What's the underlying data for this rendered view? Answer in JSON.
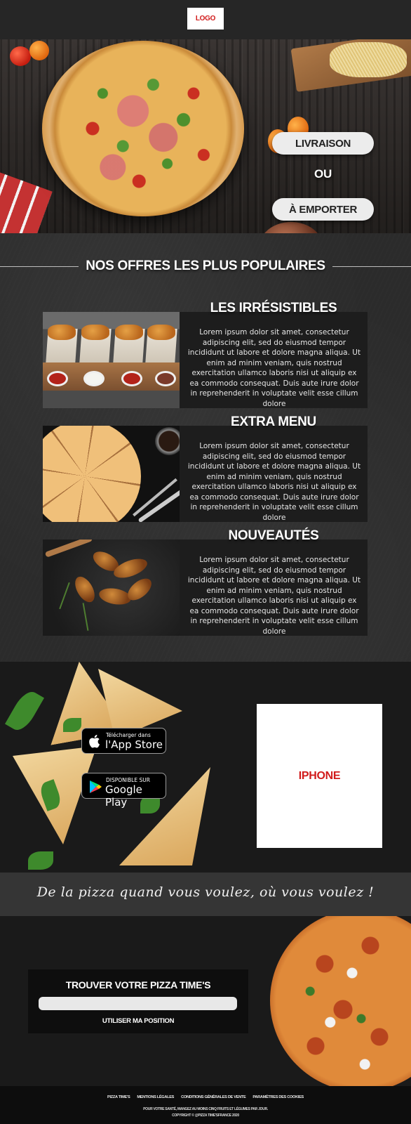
{
  "header": {
    "logo_label": "LOGO"
  },
  "hero": {
    "delivery_button": "LIVRAISON",
    "or_text": "OU",
    "takeaway_button": "À EMPORTER"
  },
  "offers": {
    "title": "NOS OFFRES LES PLUS POPULAIRES",
    "items": [
      {
        "title": "LES IRRÉSISTIBLES",
        "text": "Lorem ipsum dolor sit amet, consectetur adipiscing elit, sed do eiusmod tempor incididunt ut labore et dolore magna aliqua. Ut enim ad minim veniam, quis nostrud exercitation ullamco laboris nisi ut aliquip ex ea commodo consequat. Duis aute irure dolor in reprehenderit in voluptate velit esse cillum dolore"
      },
      {
        "title": "EXTRA MENU",
        "text": "Lorem ipsum dolor sit amet, consectetur adipiscing elit, sed do eiusmod tempor incididunt ut labore et dolore magna aliqua. Ut enim ad minim veniam, quis nostrud exercitation ullamco laboris nisi ut aliquip ex ea commodo consequat. Duis aute irure dolor in reprehenderit in voluptate velit esse cillum dolore"
      },
      {
        "title": "NOUVEAUTÉS",
        "text": "Lorem ipsum dolor sit amet, consectetur adipiscing elit, sed do eiusmod tempor incididunt ut labore et dolore magna aliqua. Ut enim ad minim veniam, quis nostrud exercitation ullamco laboris nisi ut aliquip ex ea commodo consequat. Duis aute irure dolor in reprehenderit in voluptate velit esse cillum dolore"
      }
    ]
  },
  "app": {
    "appstore_small": "Télécharger dans",
    "appstore_big": "l'App Store",
    "googleplay_small": "DISPONIBLE SUR",
    "googleplay_big": "Google Play",
    "phone_label": "IPHONE"
  },
  "tagline": "De la pizza quand vous voulez, où vous voulez !",
  "finder": {
    "title": "TROUVER VOTRE PIZZA TIME'S",
    "input_value": "",
    "use_position": "UTILISER MA POSITION"
  },
  "footer": {
    "links": [
      "PIZZA TIME'S",
      "MENTIONS LÉGALES",
      "CONDITIONS GÉNÉRALES DE VENTE",
      "PARAMÈTRES DES COOKIES"
    ],
    "note": "POUR VOTRE SANTÉ, MANGEZ AU MOINS CINQ FRUITS ET LÉGUMES PAR JOUR.",
    "copyright": "COPYRIGHT © @PIZZA TIME'SFRANCE 2020"
  },
  "colors": {
    "accent_red": "#d11b1b",
    "button_light": "#ececec"
  }
}
